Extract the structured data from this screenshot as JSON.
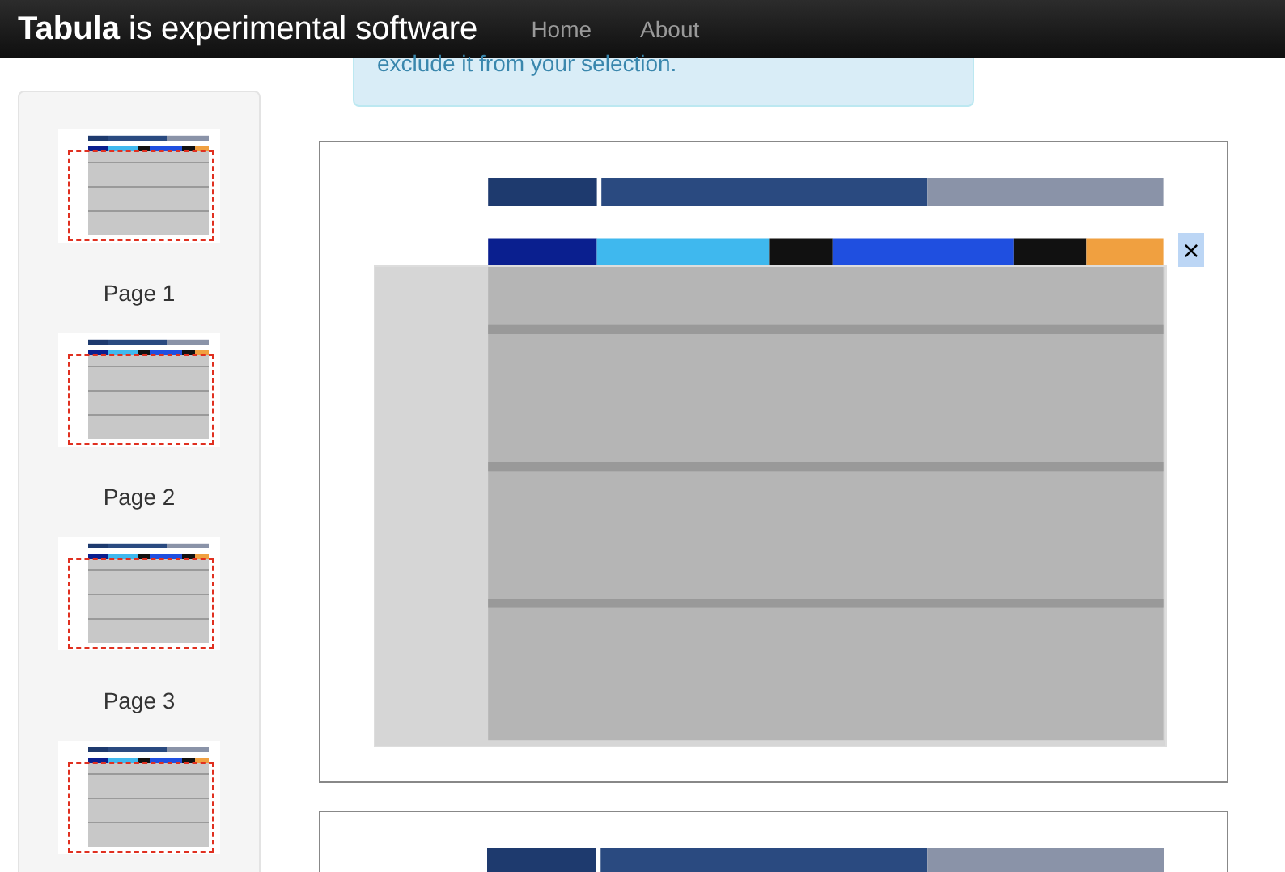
{
  "navbar": {
    "brand_bold": "Tabula",
    "brand_rest": "is experimental software",
    "links": [
      {
        "label": "Home"
      },
      {
        "label": "About"
      }
    ]
  },
  "alert": {
    "text": "exclude it from your selection."
  },
  "thumbnails": [
    {
      "label": "Page 1",
      "has_selection": true
    },
    {
      "label": "Page 2",
      "has_selection": true
    },
    {
      "label": "Page 3",
      "has_selection": true
    },
    {
      "has_selection": true
    }
  ],
  "pages": [
    {
      "has_selection": true,
      "remove_button": "×"
    },
    {
      "has_selection": false
    }
  ]
}
